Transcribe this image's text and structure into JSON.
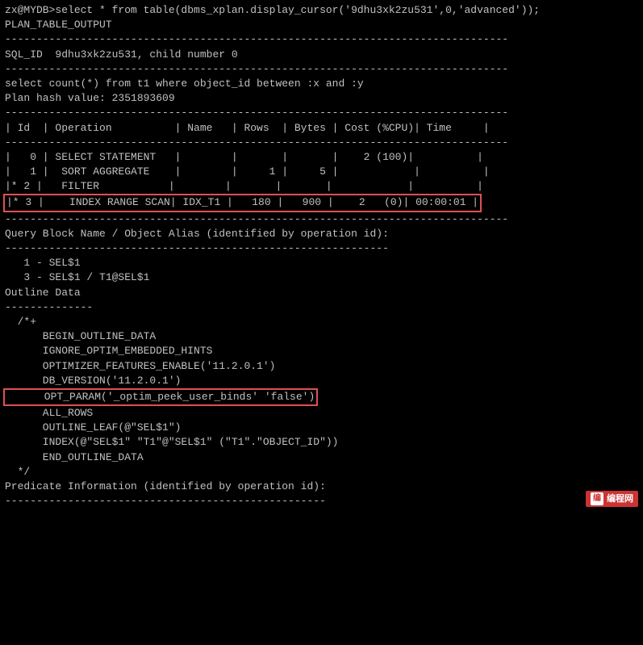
{
  "terminal": {
    "lines": [
      {
        "id": "cmd",
        "text": "zx@MYDB>select * from table(dbms_xplan.display_cursor('9dhu3xk2zu531',0,'advanced'));",
        "highlight": false
      },
      {
        "id": "blank1",
        "text": "",
        "highlight": false
      },
      {
        "id": "plan_output_label",
        "text": "PLAN_TABLE_OUTPUT",
        "highlight": false
      },
      {
        "id": "sep1",
        "text": "--------------------------------------------------------------------------------",
        "highlight": false
      },
      {
        "id": "sql_id",
        "text": "SQL_ID  9dhu3xk2zu531, child number 0",
        "highlight": false
      },
      {
        "id": "sep2",
        "text": "--------------------------------------------------------------------------------",
        "highlight": false
      },
      {
        "id": "select_stmt",
        "text": "select count(*) from t1 where object_id between :x and :y",
        "highlight": false
      },
      {
        "id": "blank2",
        "text": "",
        "highlight": false
      },
      {
        "id": "plan_hash",
        "text": "Plan hash value: 2351893609",
        "highlight": false
      },
      {
        "id": "blank3",
        "text": "",
        "highlight": false
      },
      {
        "id": "sep3",
        "text": "--------------------------------------------------------------------------------",
        "highlight": false
      },
      {
        "id": "col_header",
        "text": "| Id  | Operation          | Name   | Rows  | Bytes | Cost (%CPU)| Time     |",
        "highlight": false
      },
      {
        "id": "sep4",
        "text": "--------------------------------------------------------------------------------",
        "highlight": false
      },
      {
        "id": "row0",
        "text": "|   0 | SELECT STATEMENT   |        |       |       |    2 (100)|          |",
        "highlight": false
      },
      {
        "id": "row1",
        "text": "|   1 |  SORT AGGREGATE    |        |     1 |     5 |            |          |",
        "highlight": false
      },
      {
        "id": "row2",
        "text": "|* 2 |   FILTER           |        |       |       |            |          |",
        "highlight": false
      },
      {
        "id": "row3",
        "text": "|* 3 |    INDEX RANGE SCAN| IDX_T1 |   180 |   900 |    2   (0)| 00:00:01 |",
        "highlight": true
      },
      {
        "id": "sep5",
        "text": "--------------------------------------------------------------------------------",
        "highlight": false
      },
      {
        "id": "blank4",
        "text": "",
        "highlight": false
      },
      {
        "id": "qb_label",
        "text": "Query Block Name / Object Alias (identified by operation id):",
        "highlight": false
      },
      {
        "id": "sep6",
        "text": "-------------------------------------------------------------",
        "highlight": false
      },
      {
        "id": "blank5",
        "text": "",
        "highlight": false
      },
      {
        "id": "alias1",
        "text": "   1 - SEL$1",
        "highlight": false
      },
      {
        "id": "alias2",
        "text": "   3 - SEL$1 / T1@SEL$1",
        "highlight": false
      },
      {
        "id": "blank6",
        "text": "",
        "highlight": false
      },
      {
        "id": "outline_label",
        "text": "Outline Data",
        "highlight": false
      },
      {
        "id": "sep7",
        "text": "--------------",
        "highlight": false
      },
      {
        "id": "blank7",
        "text": "",
        "highlight": false
      },
      {
        "id": "outline_open",
        "text": "  /*+",
        "highlight": false
      },
      {
        "id": "outline1",
        "text": "      BEGIN_OUTLINE_DATA",
        "highlight": false
      },
      {
        "id": "outline2",
        "text": "      IGNORE_OPTIM_EMBEDDED_HINTS",
        "highlight": false
      },
      {
        "id": "outline3",
        "text": "      OPTIMIZER_FEATURES_ENABLE('11.2.0.1')",
        "highlight": false
      },
      {
        "id": "outline4",
        "text": "      DB_VERSION('11.2.0.1')",
        "highlight": false
      },
      {
        "id": "outline5",
        "text": "      OPT_PARAM('_optim_peek_user_binds' 'false')",
        "highlight": true
      },
      {
        "id": "outline6",
        "text": "      ALL_ROWS",
        "highlight": false
      },
      {
        "id": "outline7",
        "text": "      OUTLINE_LEAF(@\"SEL$1\")",
        "highlight": false
      },
      {
        "id": "outline8",
        "text": "      INDEX(@\"SEL$1\" \"T1\"@\"SEL$1\" (\"T1\".\"OBJECT_ID\"))",
        "highlight": false
      },
      {
        "id": "outline9",
        "text": "      END_OUTLINE_DATA",
        "highlight": false
      },
      {
        "id": "outline_close",
        "text": "  */",
        "highlight": false
      },
      {
        "id": "blank8",
        "text": "",
        "highlight": false
      },
      {
        "id": "pred_label",
        "text": "Predicate Information (identified by operation id):",
        "highlight": false
      },
      {
        "id": "sep8",
        "text": "---------------------------------------------------",
        "highlight": false
      }
    ]
  },
  "watermark": {
    "icon_text": "编",
    "label": "编程网"
  }
}
